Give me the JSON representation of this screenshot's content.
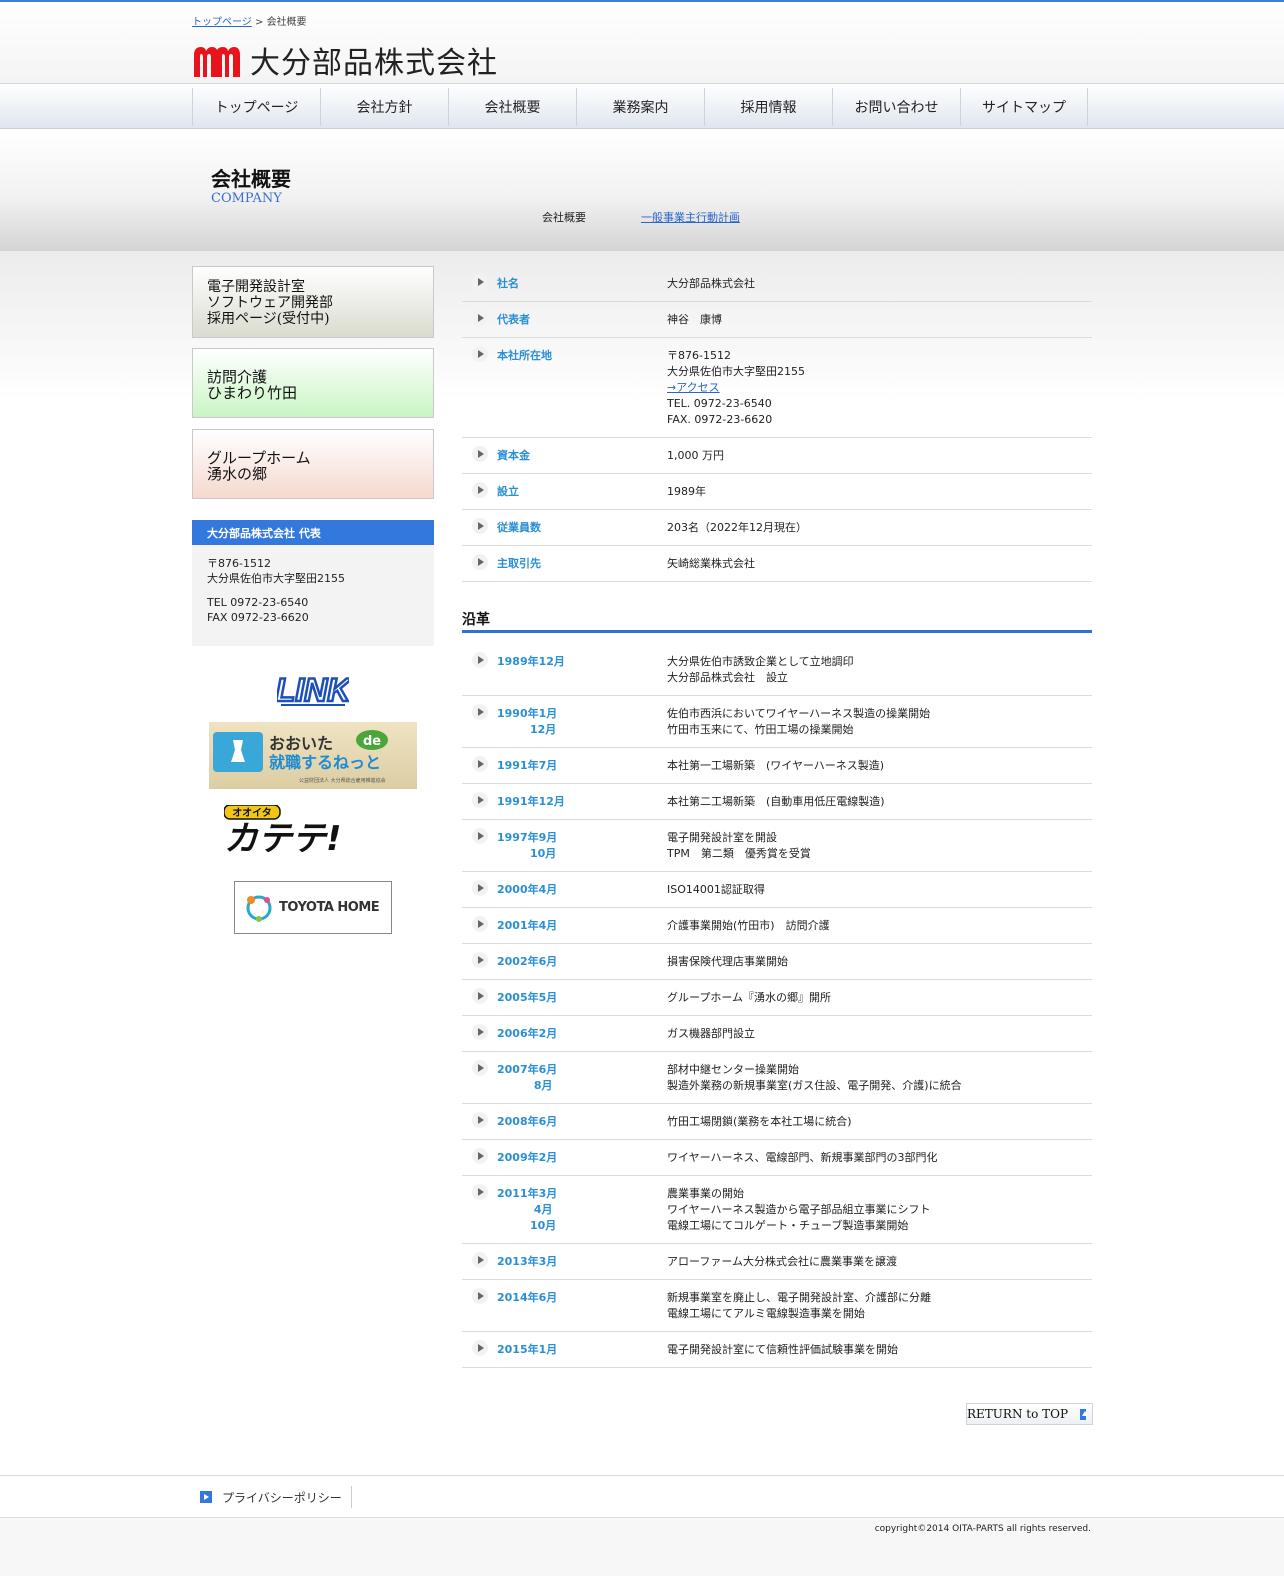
{
  "breadcrumb": {
    "home": "トップページ",
    "separator": " > ",
    "current": "会社概要"
  },
  "site": {
    "company_name": "大分部品株式会社",
    "logo_icon": "mm-logo-icon"
  },
  "nav": {
    "items": [
      "トップページ",
      "会社方針",
      "会社概要",
      "業務案内",
      "採用情報",
      "お問い合わせ",
      "サイトマップ"
    ]
  },
  "page": {
    "title": "会社概要",
    "subtitle": "COMPANY",
    "subnav_current": "会社概要",
    "subnav_link": "一般事業主行動計画"
  },
  "sidebar": {
    "banners": [
      "電子開発設計室\nソフトウェア開発部\n採用ページ(受付中)",
      "訪問介護\nひまわり竹田",
      "グループホーム\n湧水の郷"
    ],
    "contact": {
      "heading": "大分部品株式会社 代表",
      "postal": "〒876-1512",
      "address": "大分県佐伯市大字堅田2155",
      "tel": "TEL 0972-23-6540",
      "fax": "FAX 0972-23-6620"
    },
    "links_heading": "LINK",
    "links": {
      "oita_main": "おおいた",
      "oita_de": "de",
      "oita_sub": "就職するねっと",
      "oita_note": "公益財団法人 大分県総合雇用推進協会",
      "katete_small": "オオイタ",
      "katete_main": "カテテ!",
      "toyota": "TOYOTA HOME"
    }
  },
  "company_info": [
    {
      "label": "社名",
      "value": "大分部品株式会社"
    },
    {
      "label": "代表者",
      "value": "神谷　康博"
    },
    {
      "label": "本社所在地",
      "value_pre": "〒876-1512\n大分県佐伯市大字堅田2155",
      "access_link": "→アクセス",
      "value_post": "TEL. 0972-23-6540\nFAX. 0972-23-6620"
    },
    {
      "label": "資本金",
      "value": "1,000 万円"
    },
    {
      "label": "設立",
      "value": "1989年"
    },
    {
      "label": "従業員数",
      "value": "203名（2022年12月現在）"
    },
    {
      "label": "主取引先",
      "value": "矢崎総業株式会社"
    }
  ],
  "history": {
    "title": "沿革",
    "items": [
      {
        "date": "1989年12月",
        "text": "大分県佐伯市誘致企業として立地調印\n大分部品株式会社　設立"
      },
      {
        "date": "1990年1月\n　　　12月",
        "text": "佐伯市西浜においてワイヤーハーネス製造の操業開始\n竹田市玉来にて、竹田工場の操業開始"
      },
      {
        "date": "1991年7月",
        "text": "本社第一工場新築　(ワイヤーハーネス製造)"
      },
      {
        "date": "1991年12月",
        "text": "本社第二工場新築　(自動車用低圧電線製造)"
      },
      {
        "date": "1997年9月\n　　　10月",
        "text": "電子開発設計室を開設\nTPM　第二類　優秀賞を受賞"
      },
      {
        "date": "2000年4月",
        "text": "ISO14001認証取得"
      },
      {
        "date": "2001年4月",
        "text": "介護事業開始(竹田市)　訪問介護"
      },
      {
        "date": "2002年6月",
        "text": "損害保険代理店事業開始"
      },
      {
        "date": "2005年5月",
        "text": "グループホーム『湧水の郷』開所"
      },
      {
        "date": "2006年2月",
        "text": "ガス機器部門設立"
      },
      {
        "date": "2007年6月\n　　　 8月",
        "text": "部材中継センター操業開始\n製造外業務の新規事業室(ガス住設、電子開発、介護)に統合"
      },
      {
        "date": "2008年6月",
        "text": "竹田工場閉鎖(業務を本社工場に統合)"
      },
      {
        "date": "2009年2月",
        "text": "ワイヤーハーネス、電線部門、新規事業部門の3部門化"
      },
      {
        "date": "2011年3月\n　　　 4月\n　　　10月",
        "text": "農業事業の開始\nワイヤーハーネス製造から電子部品組立事業にシフト\n電線工場にてコルゲート・チューブ製造事業開始"
      },
      {
        "date": "2013年3月",
        "text": "アローファーム大分株式会社に農業事業を譲渡"
      },
      {
        "date": "2014年6月",
        "text": "新規事業室を廃止し、電子開発設計室、介護部に分離\n電線工場にてアルミ電線製造事業を開始"
      },
      {
        "date": "2015年1月",
        "text": "電子開発設計室にて信頼性評価試験事業を開始"
      }
    ]
  },
  "return_top": "RETURN to TOP",
  "footer": {
    "privacy": "プライバシーポリシー",
    "copyright": "copyright©2014 OITA-PARTS all rights reserved."
  },
  "colors": {
    "accent": "#3378dc",
    "label": "#2a8fd5",
    "logo_red": "#e8141c"
  }
}
